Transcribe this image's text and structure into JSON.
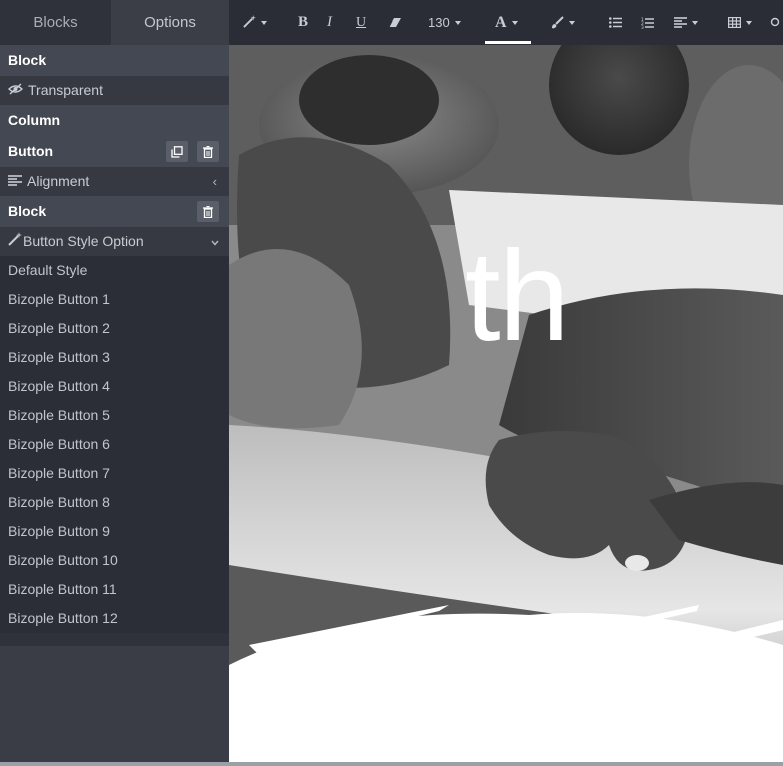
{
  "tabs": [
    {
      "label": "Blocks"
    },
    {
      "label": "Options"
    }
  ],
  "panel": {
    "block_title": "Block",
    "transparent_label": "Transparent",
    "column_title": "Column",
    "button_title": "Button",
    "alignment_label": "Alignment",
    "block2_title": "Block",
    "button_style_option_label": "Button Style Option",
    "styles": [
      "Default Style",
      "Bizople Button 1",
      "Bizople Button 2",
      "Bizople Button 3",
      "Bizople Button 4",
      "Bizople Button 5",
      "Bizople Button 6",
      "Bizople Button 7",
      "Bizople Button 8",
      "Bizople Button 9",
      "Bizople Button 10",
      "Bizople Button 11",
      "Bizople Button 12"
    ]
  },
  "toolbar": {
    "font_size": "130",
    "bold": "B",
    "italic": "I",
    "underline": "U",
    "font_color": "A"
  },
  "canvas": {
    "hero_text": "th"
  },
  "colors": {
    "panel_bg": "#2f323b",
    "section_head_bg": "#444852",
    "toolbar_bg": "#2a2d35"
  },
  "icons": [
    "magic-wand-icon",
    "eraser-icon",
    "paint-brush-icon",
    "unordered-list-icon",
    "ordered-list-icon",
    "align-left-icon",
    "table-icon",
    "eye-slash-icon",
    "clone-icon",
    "trash-icon",
    "align-icon",
    "chevron-left-icon",
    "chevron-down-icon"
  ]
}
